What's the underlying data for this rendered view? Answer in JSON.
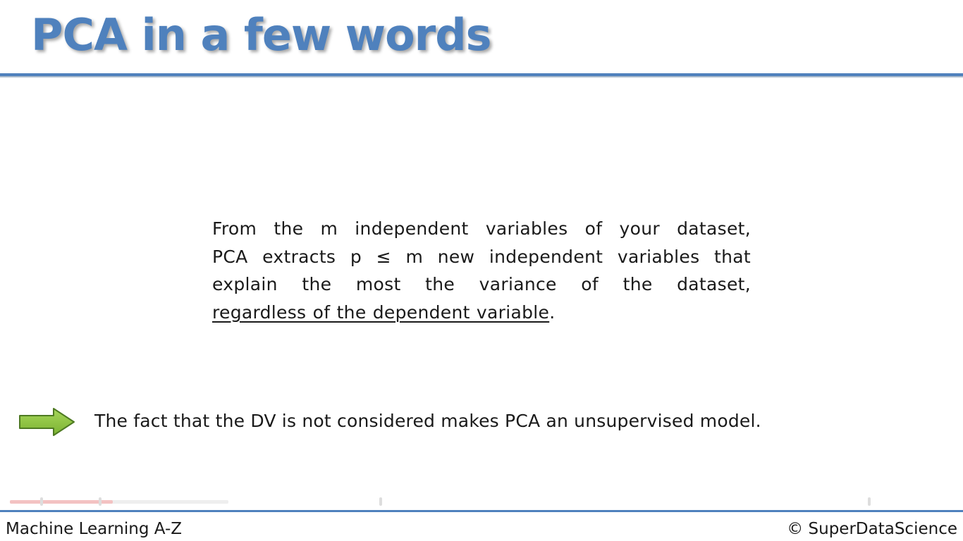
{
  "slide": {
    "title": "PCA in a few words",
    "paragraph": {
      "line1": "From the m independent variables of your dataset,",
      "line2": "PCA extracts p ≤ m new independent variables that",
      "line3": "explain the most the variance of the dataset,",
      "line4_underlined": "regardless of the dependent variable",
      "line4_tail": "."
    },
    "conclusion": "The fact that the DV is not considered makes PCA an unsupervised model.",
    "arrow_icon": "right-arrow-icon"
  },
  "footer": {
    "left": "Machine Learning A-Z",
    "right": "© SuperDataScience"
  },
  "player": {
    "progress_fraction": 0.47
  },
  "colors": {
    "accent": "#4f81bd",
    "arrow_fill": "#8ec53f",
    "arrow_stroke": "#4e7a22",
    "progress": "#f3c2c2"
  }
}
